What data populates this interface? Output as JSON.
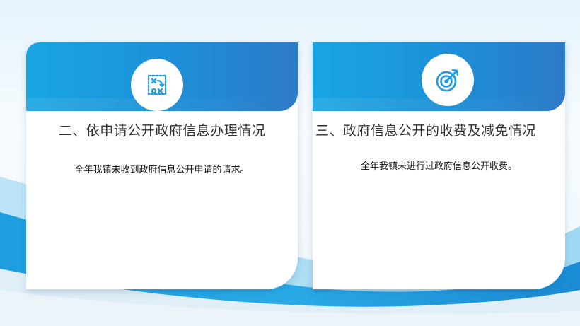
{
  "cards": [
    {
      "icon": "strategy-board-icon",
      "title": "二、依申请公开政府信息办理情况",
      "body": "全年我镇未收到政府信息公开申请的请求。"
    },
    {
      "icon": "target-arrow-icon",
      "title": "三、政府信息公开的收费及减免情况",
      "body": "全年我镇未进行过政府信息公开收费。"
    }
  ],
  "colors": {
    "accent": "#1d8fd8",
    "accent_light": "#1aa6e2",
    "title_text": "#2f2f2f",
    "body_text": "#111111"
  }
}
